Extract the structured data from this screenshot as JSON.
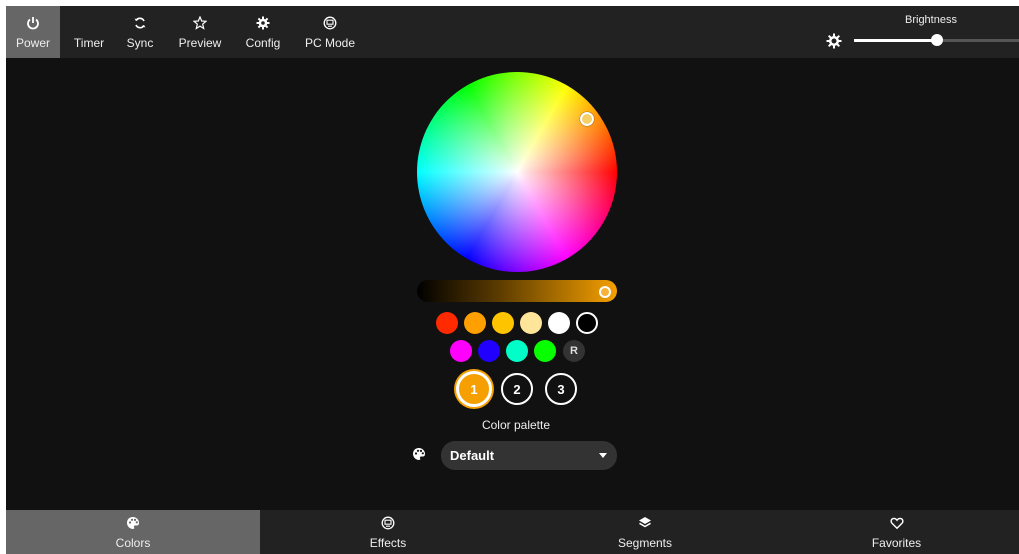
{
  "topbar": {
    "buttons": [
      {
        "label": "Power",
        "icon": "power-icon",
        "active": true
      },
      {
        "label": "Timer",
        "icon": "moon-icon",
        "active": false
      },
      {
        "label": "Sync",
        "icon": "sync-icon",
        "active": false
      },
      {
        "label": "Preview",
        "icon": "star-icon",
        "active": false
      },
      {
        "label": "Config",
        "icon": "gear-icon",
        "active": false
      },
      {
        "label": "PC Mode",
        "icon": "screen-icon",
        "active": false
      }
    ],
    "brightness": {
      "label": "Brightness",
      "icon": "brightness-icon",
      "value": 0.5
    }
  },
  "color": {
    "wheel_selected": "#f4d066",
    "value_slider_color": "#f5a000",
    "swatches_row1": [
      "#ff2a00",
      "#ffa000",
      "#ffc400",
      "#ffe59a",
      "#ffffff",
      "#000000"
    ],
    "swatches_row2": [
      "#ff00ff",
      "#2200ff",
      "#00ffc8",
      "#08ff00"
    ],
    "random_label": "R",
    "slots": [
      "1",
      "2",
      "3"
    ],
    "active_slot": "1",
    "palette_label": "Color palette",
    "palette_icon": "palette-icon",
    "palette_value": "Default"
  },
  "bottombar": {
    "tabs": [
      {
        "label": "Colors",
        "icon": "palette-icon",
        "active": true
      },
      {
        "label": "Effects",
        "icon": "effects-icon",
        "active": false
      },
      {
        "label": "Segments",
        "icon": "layers-icon",
        "active": false
      },
      {
        "label": "Favorites",
        "icon": "heart-icon",
        "active": false
      }
    ]
  },
  "colors": {
    "background": "#111111",
    "bar": "#222222",
    "active_button": "#666666",
    "accent": "#f5a000"
  }
}
